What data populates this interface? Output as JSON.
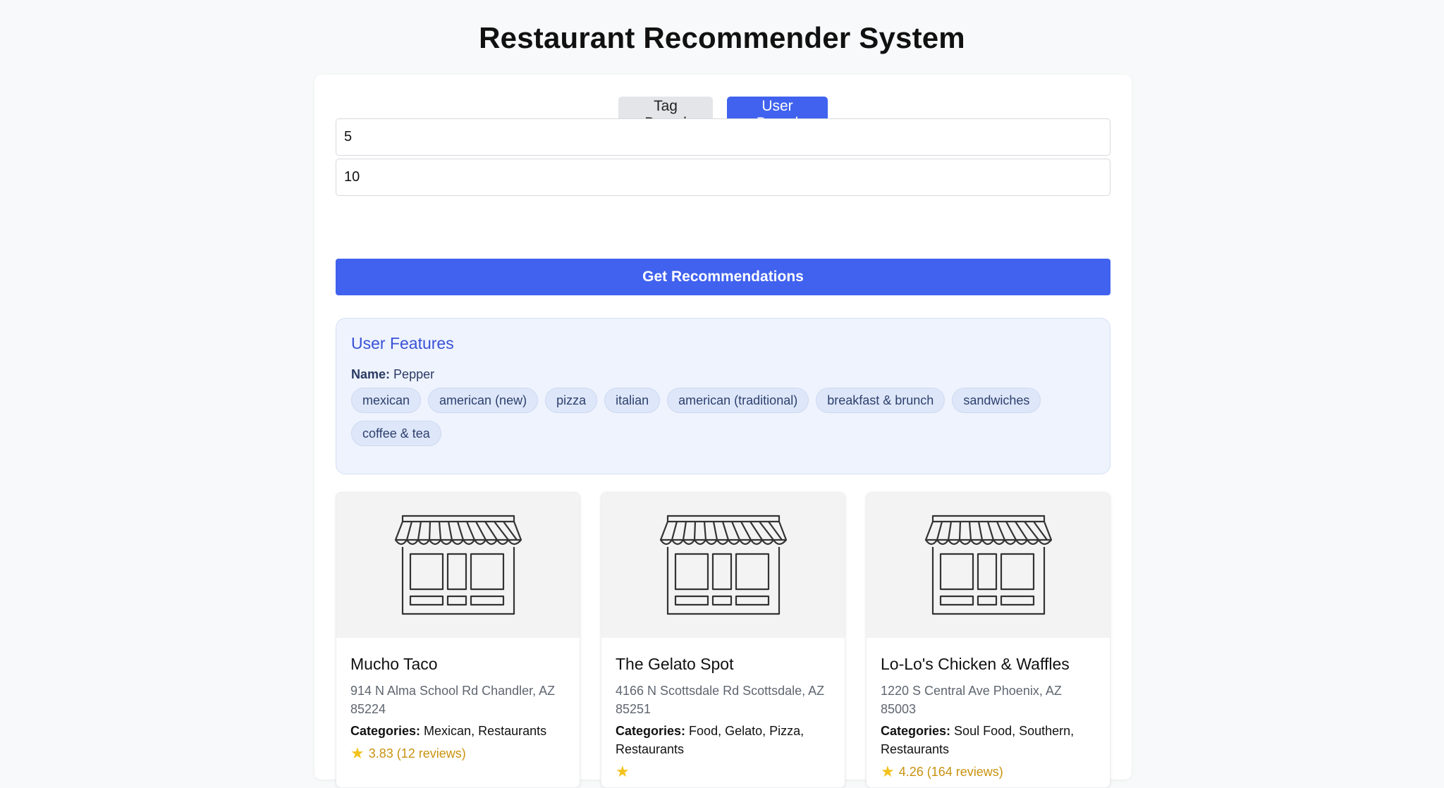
{
  "page": {
    "title": "Restaurant Recommender System"
  },
  "modes": {
    "tag_based": "Tag Based",
    "user_based": "User Based",
    "active": "user_based"
  },
  "inputs": {
    "first_value": "5",
    "second_value": "10"
  },
  "submit_label": "Get Recommendations",
  "user_features": {
    "title": "User Features",
    "name_label": "Name:",
    "name_value": "Pepper",
    "tags": [
      "mexican",
      "american (new)",
      "pizza",
      "italian",
      "american (traditional)",
      "breakfast & brunch",
      "sandwiches",
      "coffee & tea"
    ]
  },
  "categories_label": "Categories:",
  "restaurants": [
    {
      "name": "Mucho Taco",
      "address": "914 N Alma School Rd Chandler, AZ 85224",
      "categories": "Mexican, Restaurants",
      "rating": "3.83 (12 reviews)"
    },
    {
      "name": "The Gelato Spot",
      "address": "4166 N Scottsdale Rd Scottsdale, AZ 85251",
      "categories": "Food, Gelato, Pizza, Restaurants",
      "rating": ""
    },
    {
      "name": "Lo-Lo's Chicken & Waffles",
      "address": "1220 S Central Ave Phoenix, AZ 85003",
      "categories": "Soul Food, Southern, Restaurants",
      "rating": "4.26 (164 reviews)"
    }
  ],
  "colors": {
    "accent": "#4062ee",
    "feature_title": "#3851d6",
    "rating": "#c8920f",
    "star": "#f3c21c"
  }
}
